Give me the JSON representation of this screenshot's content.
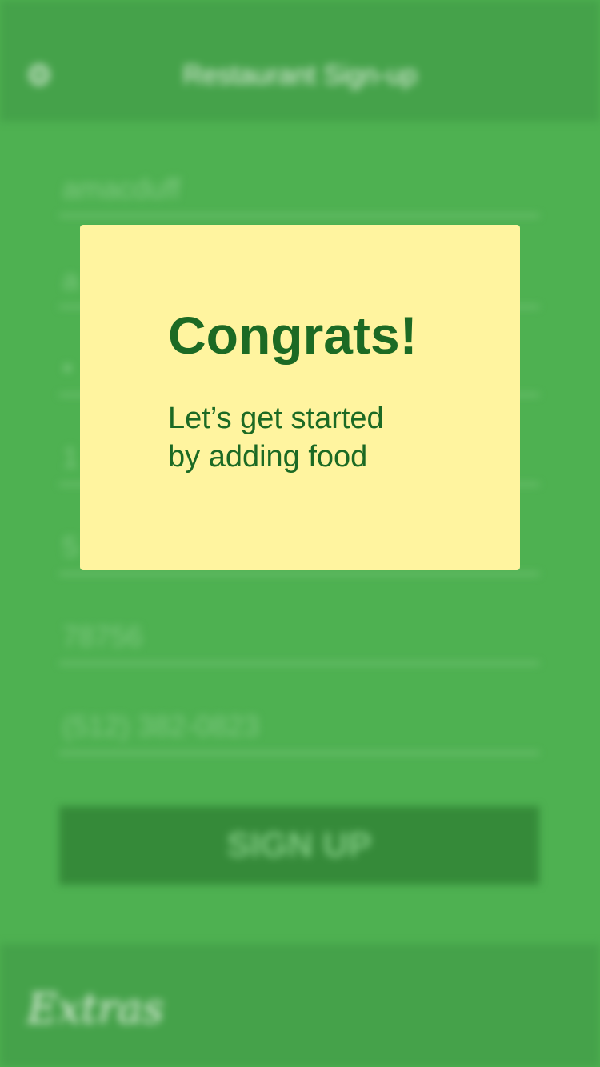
{
  "header": {
    "title": "Restaurant Sign-up",
    "settings_icon": "gear-icon"
  },
  "form": {
    "fields": [
      {
        "value": "amacduff"
      },
      {
        "value": "a"
      },
      {
        "value": "•"
      },
      {
        "value": "1"
      },
      {
        "value": "5"
      },
      {
        "value": "78756"
      },
      {
        "value": "(512) 382-0823"
      }
    ],
    "submit_label": "SIGN UP"
  },
  "footer": {
    "logo_text": "Extras"
  },
  "modal": {
    "title": "Congrats!",
    "message_line1": "Let’s get started",
    "message_line2": "by adding food"
  },
  "colors": {
    "background": "#4eb151",
    "bar": "#45a24a",
    "button": "#358a39",
    "modal_background": "#fff49f",
    "modal_text": "#1c6a24"
  }
}
